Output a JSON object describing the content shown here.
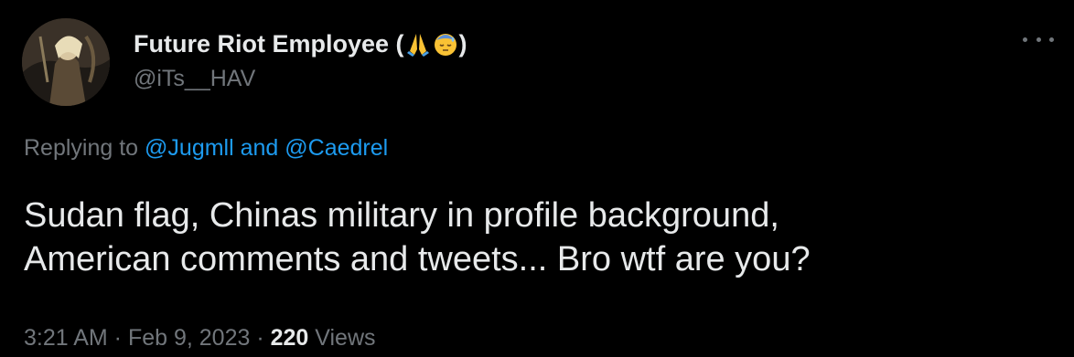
{
  "author": {
    "display_name": "Future Riot Employee (",
    "display_name_end": ")",
    "emojis": [
      "folded-hands-emoji",
      "face-with-sweat-emoji"
    ],
    "handle": "@iTs__HAV"
  },
  "reply": {
    "prefix": "Replying to ",
    "mention_1": "@Jugmll",
    "joiner": " and ",
    "mention_2": "@Caedrel"
  },
  "tweet": {
    "line_1": "Sudan flag, Chinas military in profile background,",
    "line_2": "American comments and tweets... Bro wtf are you?"
  },
  "meta": {
    "time": "3:21 AM",
    "sep_1": " · ",
    "date": "Feb 9, 2023",
    "sep_2": " · ",
    "views_count": "220",
    "views_label": " Views"
  },
  "colors": {
    "background": "#000000",
    "text": "#e7e9ea",
    "secondary": "#71767b",
    "link": "#1d9bf0"
  }
}
